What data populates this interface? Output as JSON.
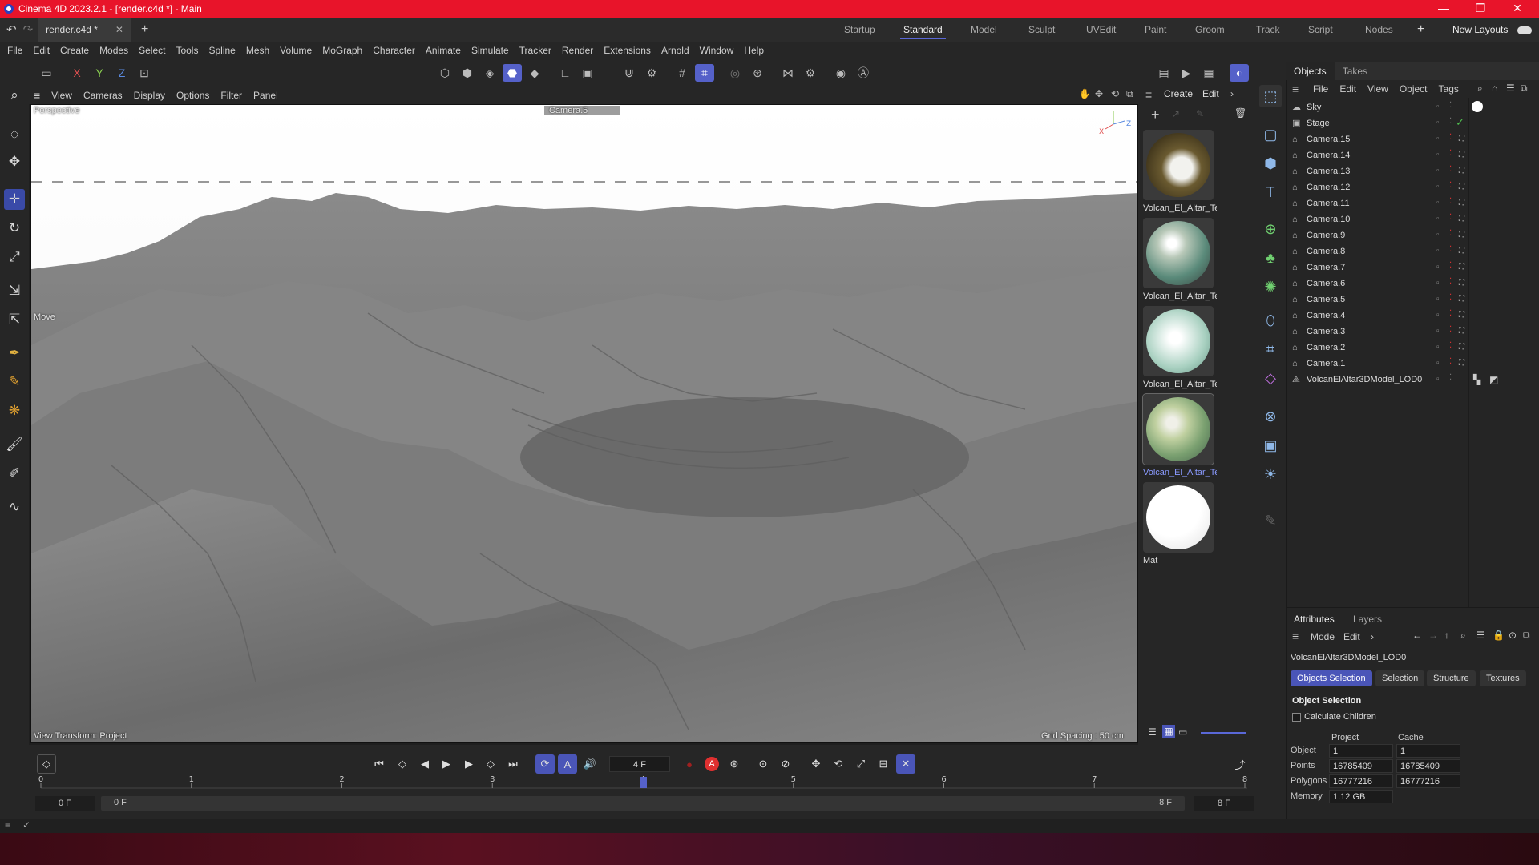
{
  "window": {
    "title": "Cinema 4D 2023.2.1 - [render.c4d *] - Main",
    "min": "—",
    "max": "❐",
    "close": "✕"
  },
  "tabs": {
    "file": "render.c4d *",
    "add": "+"
  },
  "layouts": [
    "Startup",
    "Standard",
    "Model",
    "Sculpt",
    "UVEdit",
    "Paint",
    "Groom",
    "Track",
    "Script",
    "Nodes"
  ],
  "layout_active": "Standard",
  "new_layouts": "New Layouts",
  "menu": [
    "File",
    "Edit",
    "Create",
    "Modes",
    "Select",
    "Tools",
    "Spline",
    "Mesh",
    "Volume",
    "MoGraph",
    "Character",
    "Animate",
    "Simulate",
    "Tracker",
    "Render",
    "Extensions",
    "Arnold",
    "Window",
    "Help"
  ],
  "axes": {
    "x": "X",
    "y": "Y",
    "z": "Z"
  },
  "viewport_menu": [
    "View",
    "Cameras",
    "Display",
    "Options",
    "Filter",
    "Panel"
  ],
  "viewport": {
    "view_name": "Perspective",
    "camera": "Camera.5",
    "tool_label": "Move",
    "view_transform": "View Transform: Project",
    "grid_spacing": "Grid Spacing : 50 cm"
  },
  "material_menu": [
    "Create",
    "Edit"
  ],
  "materials": [
    {
      "name": "Volcan_El_Altar_Te"
    },
    {
      "name": "Volcan_El_Altar_Te"
    },
    {
      "name": "Volcan_El_Altar_Te"
    },
    {
      "name": "Volcan_El_Altar_Te"
    },
    {
      "name": "Mat"
    }
  ],
  "objects_tabs": [
    "Objects",
    "Takes"
  ],
  "objects_menu": [
    "File",
    "Edit",
    "View",
    "Object",
    "Tags"
  ],
  "objects": [
    {
      "name": "Sky",
      "icon": "sky-icon"
    },
    {
      "name": "Stage",
      "icon": "stage-icon"
    },
    {
      "name": "Camera.15",
      "icon": "camera-icon"
    },
    {
      "name": "Camera.14",
      "icon": "camera-icon"
    },
    {
      "name": "Camera.13",
      "icon": "camera-icon"
    },
    {
      "name": "Camera.12",
      "icon": "camera-icon"
    },
    {
      "name": "Camera.11",
      "icon": "camera-icon"
    },
    {
      "name": "Camera.10",
      "icon": "camera-icon"
    },
    {
      "name": "Camera.9",
      "icon": "camera-icon"
    },
    {
      "name": "Camera.8",
      "icon": "camera-icon"
    },
    {
      "name": "Camera.7",
      "icon": "camera-icon"
    },
    {
      "name": "Camera.6",
      "icon": "camera-icon"
    },
    {
      "name": "Camera.5",
      "icon": "camera-icon"
    },
    {
      "name": "Camera.4",
      "icon": "camera-icon"
    },
    {
      "name": "Camera.3",
      "icon": "camera-icon"
    },
    {
      "name": "Camera.2",
      "icon": "camera-icon"
    },
    {
      "name": "Camera.1",
      "icon": "camera-icon"
    },
    {
      "name": "VolcanElAltar3DModel_LOD0",
      "icon": "mesh-icon"
    }
  ],
  "attributes": {
    "tabs": [
      "Attributes",
      "Layers"
    ],
    "menu": [
      "Mode",
      "Edit"
    ],
    "object_name": "VolcanElAltar3DModel_LOD0",
    "subtabs": [
      "Objects Selection",
      "Selection",
      "Structure",
      "Textures"
    ],
    "section": "Object Selection",
    "calc_children": "Calculate Children",
    "col_project": "Project",
    "col_cache": "Cache",
    "rows": [
      {
        "label": "Object",
        "project": "1",
        "cache": "1"
      },
      {
        "label": "Points",
        "project": "16785409",
        "cache": "16785409"
      },
      {
        "label": "Polygons",
        "project": "16777216",
        "cache": "16777216"
      },
      {
        "label": "Memory",
        "project": "1.12 GB",
        "cache": ""
      }
    ]
  },
  "timeline": {
    "current_frame": "4 F",
    "ticks": [
      "0",
      "1",
      "2",
      "3",
      "4",
      "5",
      "6",
      "7",
      "8"
    ],
    "start": "0 F",
    "range_start": "0 F",
    "range_end": "8 F",
    "end": "8 F",
    "current_value": 4,
    "max_value": 8
  },
  "colors": {
    "accent": "#5561c9",
    "titlebar": "#e8142a",
    "record": "#e03030"
  }
}
